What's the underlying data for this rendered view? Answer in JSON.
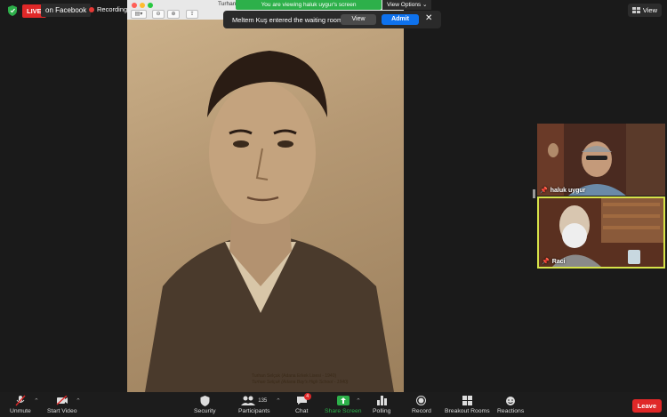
{
  "topbar": {
    "live_label": "LIVE",
    "on_facebook": "on Facebook",
    "recording": "Recording",
    "view_label": "View"
  },
  "share": {
    "viewing_banner": "You are viewing haluk uygur's screen",
    "view_options": "View Options",
    "window_title": "Turhan",
    "caption_line1": "Turhan Selçuk (Adana Erkek Lisesi - 1940)",
    "caption_line2": "Turhan Selçuk (Adana Boy's High School - 1940)"
  },
  "waiting": {
    "text": "Meltem Kuş entered the waiting room",
    "view_button": "View",
    "admit_button": "Admit",
    "close": "✕"
  },
  "participants": [
    {
      "name": "haluk uygur"
    },
    {
      "name": "Raci"
    }
  ],
  "toolbar": {
    "unmute": "Unmute",
    "start_video": "Start Video",
    "security": "Security",
    "participants": "Participants",
    "participants_count": "135",
    "chat": "Chat",
    "chat_badge": "4",
    "share_screen": "Share Screen",
    "polling": "Polling",
    "record": "Record",
    "breakout": "Breakout Rooms",
    "reactions": "Reactions",
    "leave": "Leave"
  },
  "colors": {
    "accent_blue": "#0e72ed",
    "live_red": "#e02828",
    "share_green": "#2db04a",
    "active_speaker": "#d6e34a"
  }
}
